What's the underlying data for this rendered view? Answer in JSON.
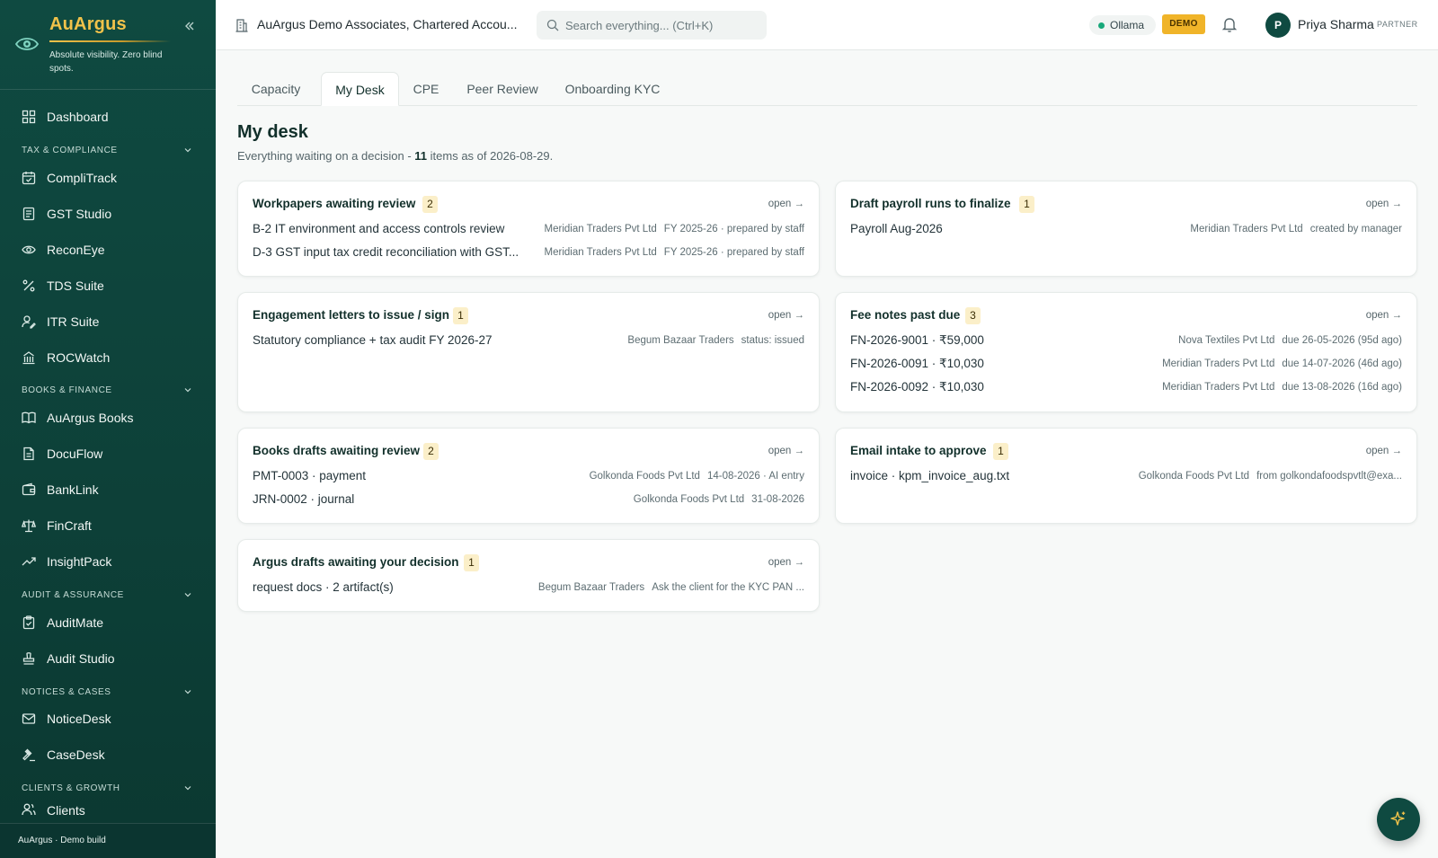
{
  "brand": {
    "name": "AuArgus",
    "tagline": "Absolute visibility. Zero blind spots."
  },
  "sidebar": {
    "dashboard": "Dashboard",
    "sections": [
      {
        "label": "TAX & COMPLIANCE",
        "items": [
          "CompliTrack",
          "GST Studio",
          "ReconEye",
          "TDS Suite",
          "ITR Suite",
          "ROCWatch"
        ]
      },
      {
        "label": "BOOKS & FINANCE",
        "items": [
          "AuArgus Books",
          "DocuFlow",
          "BankLink",
          "FinCraft",
          "InsightPack"
        ]
      },
      {
        "label": "AUDIT & ASSURANCE",
        "items": [
          "AuditMate",
          "Audit Studio"
        ]
      },
      {
        "label": "NOTICES & CASES",
        "items": [
          "NoticeDesk",
          "CaseDesk"
        ]
      },
      {
        "label": "CLIENTS & GROWTH",
        "items": [
          "Clients"
        ]
      }
    ],
    "footer": "AuArgus · Demo build"
  },
  "header": {
    "org": "AuArgus Demo Associates, Chartered Accou...",
    "search_placeholder": "Search everything... (Ctrl+K)",
    "model": "Ollama",
    "demo_badge": "DEMO",
    "user_initial": "P",
    "user_name": "Priya Sharma",
    "user_role": "PARTNER"
  },
  "tabs": [
    "Capacity",
    "My Desk",
    "CPE",
    "Peer Review",
    "Onboarding KYC"
  ],
  "active_tab": "My Desk",
  "page": {
    "title": "My desk",
    "subtitle_pre": "Everything waiting on a decision - ",
    "count": "11",
    "subtitle_post": " items as of 2026-08-29."
  },
  "open_label": "open →",
  "cards": {
    "workpapers": {
      "title": "Workpapers awaiting review",
      "count": "2",
      "rows": [
        {
          "main": "B-2 IT environment and access controls review",
          "meta1": "Meridian Traders Pvt Ltd",
          "meta2": "FY 2025-26 · prepared by staff"
        },
        {
          "main": "D-3 GST input tax credit reconciliation with GST...",
          "meta1": "Meridian Traders Pvt Ltd",
          "meta2": "FY 2025-26 · prepared by staff"
        }
      ]
    },
    "payroll": {
      "title": "Draft payroll runs to finalize",
      "count": "1",
      "rows": [
        {
          "main": "Payroll Aug-2026",
          "meta1": "Meridian Traders Pvt Ltd",
          "meta2": "created by manager"
        }
      ]
    },
    "engagement": {
      "title": "Engagement letters to issue / sign",
      "count": "1",
      "rows": [
        {
          "main": "Statutory compliance + tax audit FY 2026-27",
          "meta1": "Begum Bazaar Traders",
          "meta2": "status: issued"
        }
      ]
    },
    "fees": {
      "title": "Fee notes past due",
      "count": "3",
      "rows": [
        {
          "main": "FN-2026-9001 · ₹59,000",
          "meta1": "Nova Textiles Pvt Ltd",
          "meta2": "due 26-05-2026 (95d ago)"
        },
        {
          "main": "FN-2026-0091 · ₹10,030",
          "meta1": "Meridian Traders Pvt Ltd",
          "meta2": "due 14-07-2026 (46d ago)"
        },
        {
          "main": "FN-2026-0092 · ₹10,030",
          "meta1": "Meridian Traders Pvt Ltd",
          "meta2": "due 13-08-2026 (16d ago)"
        }
      ]
    },
    "books": {
      "title": "Books drafts awaiting review",
      "count": "2",
      "rows": [
        {
          "main": "PMT-0003 · payment",
          "meta1": "Golkonda Foods Pvt Ltd",
          "meta2": "14-08-2026 · AI entry"
        },
        {
          "main": "JRN-0002 · journal",
          "meta1": "Golkonda Foods Pvt Ltd",
          "meta2": "31-08-2026"
        }
      ]
    },
    "email": {
      "title": "Email intake to approve",
      "count": "1",
      "rows": [
        {
          "main": "invoice · kpm_invoice_aug.txt",
          "meta1": "Golkonda Foods Pvt Ltd",
          "meta2": "from golkondafoodspvtlt@exa..."
        }
      ]
    },
    "argus": {
      "title": "Argus drafts awaiting your decision",
      "count": "1",
      "rows": [
        {
          "main": "request docs · 2 artifact(s)",
          "meta1": "Begum Bazaar Traders",
          "meta2": "Ask the client for the KYC PAN ..."
        }
      ]
    }
  },
  "colors": {
    "sidebar": "#0f4a41",
    "brand_gold": "#f1c24a",
    "badge_bg": "#fbefc9",
    "demo": "#f0b429",
    "status_green": "#18a87a"
  }
}
